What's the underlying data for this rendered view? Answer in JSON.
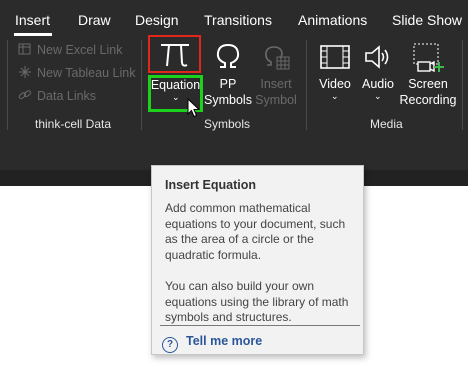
{
  "tabs": [
    {
      "label": "Insert",
      "active": true
    },
    {
      "label": "Draw",
      "active": false
    },
    {
      "label": "Design",
      "active": false
    },
    {
      "label": "Transitions",
      "active": false
    },
    {
      "label": "Animations",
      "active": false
    },
    {
      "label": "Slide Show",
      "active": false
    }
  ],
  "thinkcell": {
    "items": [
      {
        "label": "New Excel Link",
        "icon": "excel-link-icon"
      },
      {
        "label": "New Tableau Link",
        "icon": "tableau-link-icon"
      },
      {
        "label": "Data Links",
        "icon": "chain-link-icon"
      }
    ],
    "group_label": "think-cell Data"
  },
  "symbols": {
    "equation": {
      "label": "Equation",
      "chevron": "⌄",
      "icon": "pi-icon"
    },
    "pp_symbols": {
      "label_line1": "PP",
      "label_line2": "Symbols",
      "icon": "omega-icon"
    },
    "insert_symbol": {
      "label_line1": "Insert",
      "label_line2": "Symbol",
      "icon": "insert-symbol-icon",
      "disabled": true
    },
    "group_label": "Symbols"
  },
  "media": {
    "video": {
      "label": "Video",
      "chevron": "⌄",
      "icon": "film-icon"
    },
    "audio": {
      "label": "Audio",
      "chevron": "⌄",
      "icon": "speaker-icon"
    },
    "screen_recording": {
      "label_line1": "Screen",
      "label_line2": "Recording",
      "icon": "screen-record-icon"
    },
    "group_label": "Media"
  },
  "tooltip": {
    "title": "Insert Equation",
    "body1": "Add common mathematical equations to your document, such as the area of a circle or the quadratic formula.",
    "body2": "You can also build your own equations using the library of math symbols and structures.",
    "help": "Tell me more",
    "help_icon": "question-circle-icon"
  },
  "colors": {
    "ribbon_bg": "#2b2b2b",
    "highlight_red": "#e1261c",
    "highlight_green": "#1bd11b",
    "link_blue": "#2b579a",
    "screen_rec_accent": "#3fb94f"
  }
}
